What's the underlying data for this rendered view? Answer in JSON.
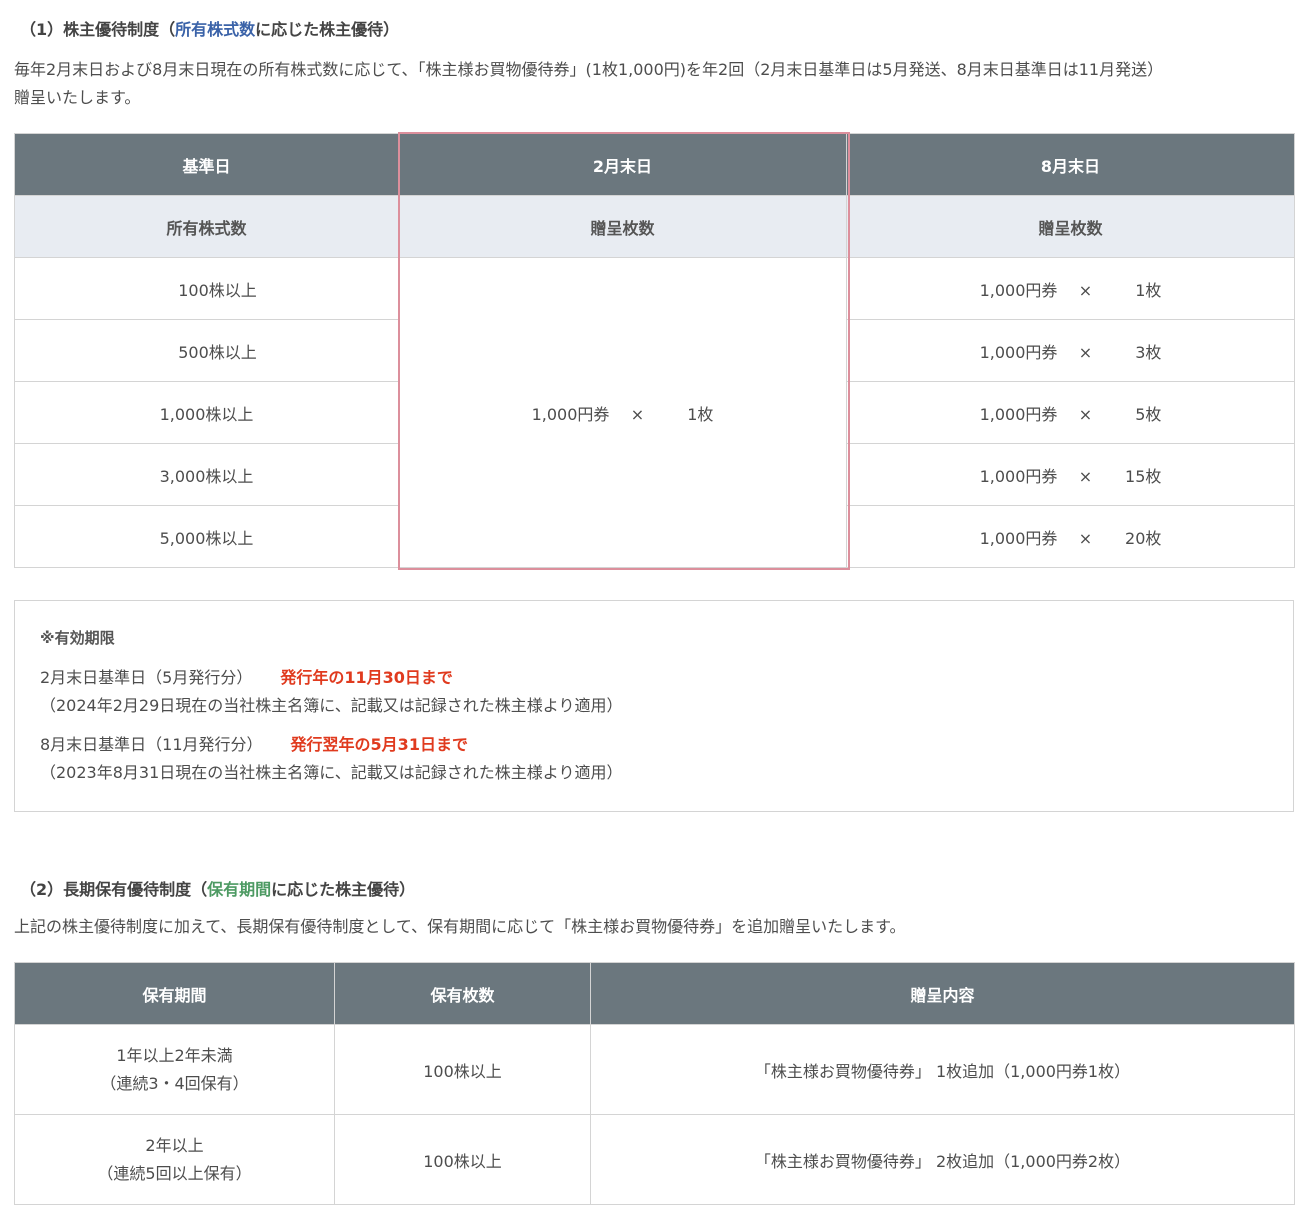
{
  "section1": {
    "title_prefix": "（1）株主優待制度（",
    "title_highlight": "所有株式数",
    "title_suffix": "に応じた株主優待）",
    "intro_line1": "毎年2月末日および8月末日現在の所有株式数に応じて、「株主様お買物優待券」(1枚1,000円)を年2回（2月末日基準日は5月発送、8月末日基準日は11月発送）",
    "intro_line2": "贈呈いたします。",
    "table": {
      "h_base": "基準日",
      "h_feb": "2月末日",
      "h_aug": "8月末日",
      "s_shares": "所有株式数",
      "s_feb": "贈呈枚数",
      "s_aug": "贈呈枚数",
      "feb_value": {
        "yen": "1,000円券",
        "x": "×",
        "count": "1枚"
      },
      "rows": [
        {
          "shares": "100株以上",
          "yen": "1,000円券",
          "x": "×",
          "count": "1枚"
        },
        {
          "shares": "500株以上",
          "yen": "1,000円券",
          "x": "×",
          "count": "3枚"
        },
        {
          "shares": "1,000株以上",
          "yen": "1,000円券",
          "x": "×",
          "count": "5枚"
        },
        {
          "shares": "3,000株以上",
          "yen": "1,000円券",
          "x": "×",
          "count": "15枚"
        },
        {
          "shares": "5,000株以上",
          "yen": "1,000円券",
          "x": "×",
          "count": "20枚"
        }
      ]
    },
    "note": {
      "title": "※有効期限",
      "line1": "2月末日基準日（5月発行分）",
      "line1_red": "発行年の11月30日まで",
      "line1_sub": "（2024年2月29日現在の当社株主名簿に、記載又は記録された株主様より適用）",
      "line2": "8月末日基準日（11月発行分）",
      "line2_red": "発行翌年の5月31日まで",
      "line2_sub": "（2023年8月31日現在の当社株主名簿に、記載又は記録された株主様より適用）"
    }
  },
  "section2": {
    "title_prefix": "（2）長期保有優待制度（",
    "title_highlight": "保有期間",
    "title_suffix": "に応じた株主優待）",
    "intro": "上記の株主優待制度に加えて、長期保有優待制度として、保有期間に応じて「株主様お買物優待券」を追加贈呈いたします。",
    "table": {
      "h_period": "保有期間",
      "h_shares": "保有枚数",
      "h_content": "贈呈内容",
      "rows": [
        {
          "period": "1年以上2年未満",
          "period_sub": "（連続3・4回保有）",
          "shares": "100株以上",
          "content": "「株主様お買物優待券」 1枚追加（1,000円券1枚）"
        },
        {
          "period": "2年以上",
          "period_sub": "（連続5回以上保有）",
          "shares": "100株以上",
          "content": "「株主様お買物優待券」 2枚追加（1,000円券2枚）"
        }
      ]
    }
  }
}
